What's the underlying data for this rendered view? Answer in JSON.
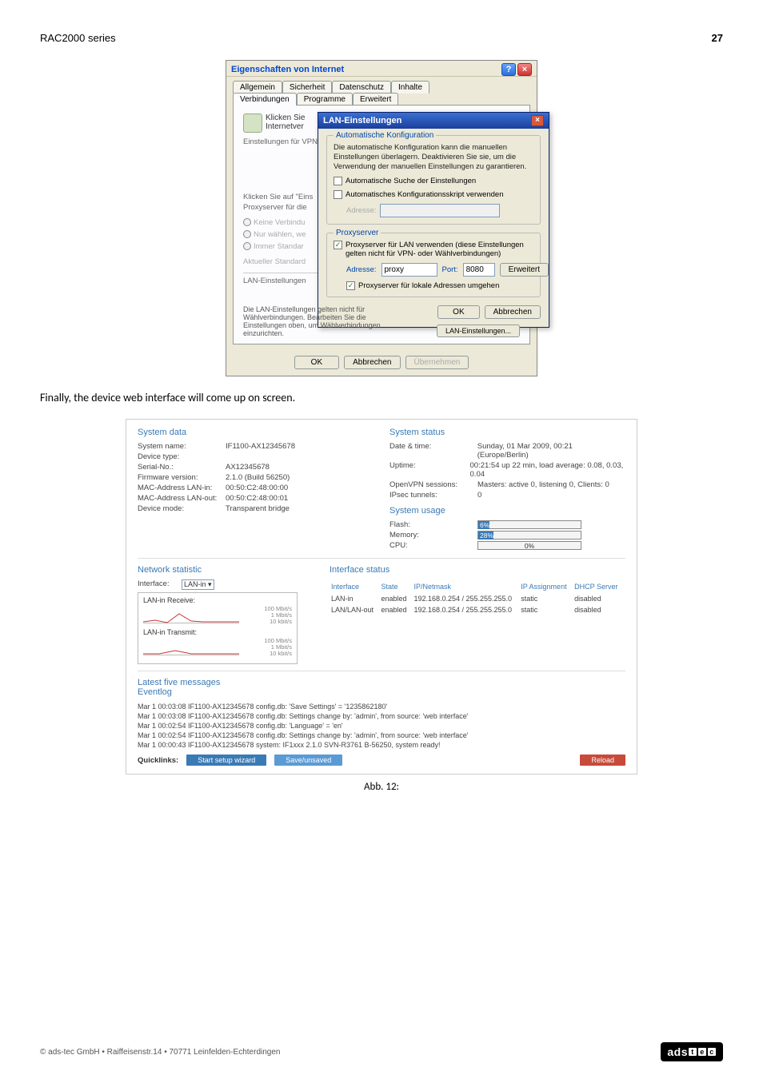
{
  "page": {
    "header_left": "RAC2000 series",
    "page_number": "27",
    "caption_text": "Finally, the device web interface will come up on screen.",
    "fig_caption": "Abb. 12:",
    "footer_text": "© ads-tec GmbH • Raiffeisenstr.14 • 70771 Leinfelden-Echterdingen",
    "logo_text": "adstec"
  },
  "win": {
    "outer_title": "Eigenschaften von Internet",
    "tabs_row1": [
      "Allgemein",
      "Sicherheit",
      "Datenschutz",
      "Inhalte"
    ],
    "tabs_row2": [
      "Verbindungen",
      "Programme",
      "Erweitert"
    ],
    "left": {
      "line1": "Klicken Sie",
      "line2": "Internetver",
      "line3": "Einstellungen für VPN",
      "line4": "Klicken Sie auf \"Eins",
      "line5": "Proxyserver für die",
      "opt1": "Keine Verbindu",
      "opt2": "Nur wählen, we",
      "opt3": "Immer Standar",
      "line6": "Aktueller Standard",
      "line7": "LAN-Einstellungen",
      "footer_note": "Die LAN-Einstellungen gelten nicht für Wählverbindungen. Bearbeiten Sie die Einstellungen oben, um Wählverbindungen einzurichten.",
      "footer_btn": "LAN-Einstellungen..."
    },
    "overlay": {
      "title": "LAN-Einstellungen",
      "fs1_legend": "Automatische Konfiguration",
      "fs1_desc": "Die automatische Konfiguration kann die manuellen Einstellungen überlagern. Deaktivieren Sie sie, um die Verwendung der manuellen Einstellungen zu garantieren.",
      "chk1": "Automatische Suche der Einstellungen",
      "chk2": "Automatisches Konfigurationsskript verwenden",
      "addr_label_disabled": "Adresse:",
      "fs2_legend": "Proxyserver",
      "fs2_chk": "Proxyserver für LAN verwenden (diese Einstellungen gelten nicht für VPN- oder Wählverbindungen)",
      "addr_label": "Adresse:",
      "addr_value": "proxy",
      "port_label": "Port:",
      "port_value": "8080",
      "adv_btn": "Erweitert",
      "bypass_chk": "Proxyserver für lokale Adressen umgehen",
      "ok": "OK",
      "cancel": "Abbrechen"
    },
    "bottom_ok": "OK",
    "bottom_cancel": "Abbrechen",
    "bottom_apply": "Übernehmen"
  },
  "web": {
    "sections": {
      "system_data": "System data",
      "system_status": "System status",
      "system_usage": "System usage",
      "network_statistic": "Network statistic",
      "interface_status": "Interface status",
      "latest_five": "Latest five messages",
      "eventlog": "Eventlog"
    },
    "sysdata": {
      "system_name_k": "System name:",
      "system_name_v": "IF1100-AX12345678",
      "device_type_k": "Device type:",
      "device_type_v": "",
      "serial_k": "Serial-No.:",
      "serial_v": "AX12345678",
      "fw_k": "Firmware version:",
      "fw_v": "2.1.0 (Build 56250)",
      "mac_in_k": "MAC-Address LAN-in:",
      "mac_in_v": "00:50:C2:48:00:00",
      "mac_out_k": "MAC-Address LAN-out:",
      "mac_out_v": "00:50:C2:48:00:01",
      "mode_k": "Device mode:",
      "mode_v": "Transparent bridge"
    },
    "sysstatus": {
      "date_k": "Date & time:",
      "date_v": "Sunday, 01 Mar 2009, 00:21 (Europe/Berlin)",
      "uptime_k": "Uptime:",
      "uptime_v": "00:21:54 up 22 min, load average: 0.08, 0.03, 0.04",
      "ovpn_k": "OpenVPN sessions:",
      "ovpn_v": "Masters: active 0, listening 0, Clients: 0",
      "ipsec_k": "IPsec tunnels:",
      "ipsec_v": "0"
    },
    "sysusage": {
      "flash_k": "Flash:",
      "flash_v": "6%",
      "mem_k": "Memory:",
      "mem_v": "28%",
      "cpu_k": "CPU:",
      "cpu_v": "0%"
    },
    "netstat": {
      "iface_k": "Interface:",
      "iface_v": "LAN-in",
      "rx_label": "LAN-in Receive:",
      "tx_label": "LAN-in Transmit:",
      "scale_top": "100 Mbit/s",
      "scale_mid": "1 Mbit/s",
      "scale_bot": "10 kbit/s"
    },
    "ifstatus": {
      "cols": [
        "Interface",
        "State",
        "IP/Netmask",
        "IP Assignment",
        "DHCP Server"
      ],
      "rows": [
        [
          "LAN-in",
          "enabled",
          "192.168.0.254 / 255.255.255.0",
          "static",
          "disabled"
        ],
        [
          "LAN/LAN-out",
          "enabled",
          "192.168.0.254 / 255.255.255.0",
          "static",
          "disabled"
        ]
      ]
    },
    "events": [
      "Mar 1 00:03:08 IF1100-AX12345678 config.db: 'Save Settings' = '1235862180'",
      "Mar 1 00:03:08 IF1100-AX12345678 config.db: Settings change by: 'admin', from source: 'web interface'",
      "Mar 1 00:02:54 IF1100-AX12345678 config.db: 'Language' = 'en'",
      "Mar 1 00:02:54 IF1100-AX12345678 config.db: Settings change by: 'admin', from source: 'web interface'",
      "Mar 1 00:00:43 IF1100-AX12345678 system: IF1xxx 2.1.0 SVN-R3761 B-56250, system ready!"
    ],
    "quicklinks": {
      "label": "Quicklinks:",
      "wizard": "Start setup wizard",
      "save": "Save/unsaved",
      "reload": "Reload"
    }
  }
}
